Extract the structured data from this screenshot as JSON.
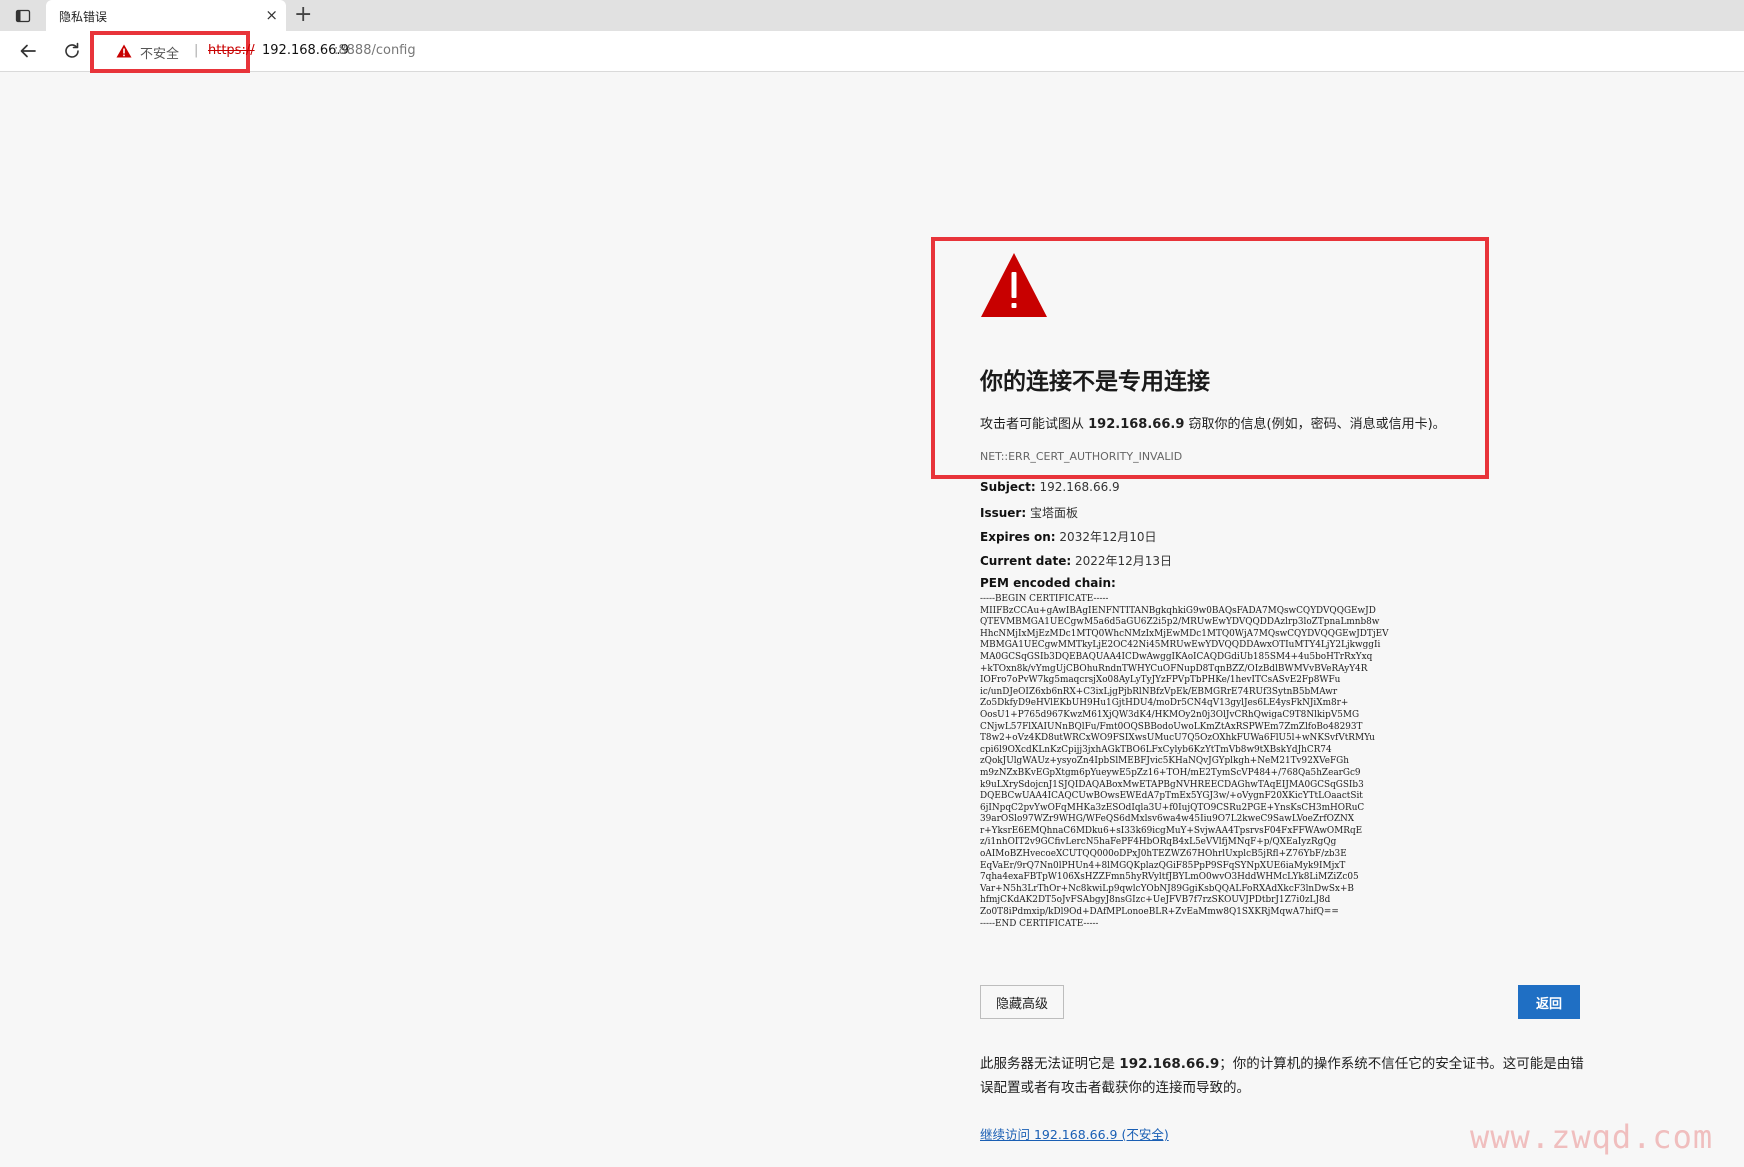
{
  "tab": {
    "title": "隐私错误",
    "close": "×",
    "new": "+"
  },
  "address": {
    "security_label": "不安全",
    "separator": "|",
    "scheme": "https://",
    "host": "192.168.66.9",
    "path": ":8888/config"
  },
  "error": {
    "heading": "你的连接不是专用连接",
    "desc_prefix": "攻击者可能试图从 ",
    "desc_host": "192.168.66.9",
    "desc_suffix": " 窃取你的信息(例如，密码、消息或信用卡)。",
    "code": "NET::ERR_CERT_AUTHORITY_INVALID"
  },
  "details": {
    "subject_label": "Subject:",
    "subject_value": " 192.168.66.9",
    "issuer_label": "Issuer:",
    "issuer_value": " 宝塔面板",
    "expires_label": "Expires on:",
    "expires_value": " 2032年12月10日",
    "current_label": "Current date:",
    "current_value": " 2022年12月13日",
    "pem_label": "PEM encoded chain:"
  },
  "pem": "-----BEGIN CERTIFICATE-----\nMIIFBzCCAu+gAwIBAgIENFNTITANBgkqhkiG9w0BAQsFADA7MQswCQYDVQQGEwJD\nQTEVMBMGA1UECgwM5a6d5aGU6Z2i5p2/MRUwEwYDVQQDDAzlrp3loZTpnaLmnb8w\nHhcNMjIxMjEzMDc1MTQ0WhcNMzIxMjEwMDc1MTQ0WjA7MQswCQYDVQQGEwJDTjEV\nMBMGA1UECgwMMTkyLjE2OC42Ni45MRUwEwYDVQQDDAwxOTIuMTY4LjY2LjkwggIi\nMA0GCSqGSIb3DQEBAQUAA4ICDwAwggIKAoICAQDGdiUb185SM4+4u5boHTrRxYxq\n+kTOxn8k/vYmgUjCBOhuRndnTWHYCuOFNupD8TqnBZZ/OIzBdlBWMVvBVeRAyY4R\nIOFro7oPvW7kg5maqcrsjXo08AyLyTyJYzFPVpTbPHKe/1hevITCsASvE2Fp8WFu\nic/unDJeOIZ6xb6nRX+C3ixLjgPjbRlNBfzVpEk/EBMGRrE74RUf3SytnB5bMAwr\nZo5DkfyD9eHVlEKbUH9Hu1GjtHDU4/moDr5CN4qV13gylJes6LE4ysFkNJiXm8r+\nOosU1+P765d967KwzM61XjQW3dK4/HKMOy2n0j3OlJvCRhQwigaC9T8NlkipV5MG\nCNjwL57FlXAIUNnBQlFu/Fmt0OQSBBodoUwoLKmZtAxRSPWEm7ZmZlfoBo48293T\nT8w2+oVz4KD8utWRCxWO9FSIXwsUMucU7Q5OzOXhkFUWa6FlU5l+wNKSvfVtRMYu\ncpi6l9OXcdKLnKzCpijj3jxhAGkTBO6LFxCylyb6KzYtTmVb8w9tXBskYdJhCR74\nzQokJUlgWAUz+ysyoZn4IpbSlMEBFJvic5KHaNQvJGYplkgh+NeM21Tv92XVeFGh\nm9zNZxBKvEGpXtgm6pYueywE5pZz16+TOH/mE2TymScVP484+/768Qa5hZearGc9\nk9uLXrySdojcnJ1SJQIDAQABoxMwETAPBgNVHREECDAGhwTAqEIJMA0GCSqGSIb3\nDQEBCwUAA4ICAQCUwBOwsEWEdA7pTmEx5YGJ3w/+oVygnF20XKicYTtLOaactSit\n6jINpqC2pvYwOFqMHKa3zESOdIqla3U+f0IujQTO9CSRu2PGE+YnsKsCH3mHORuC\n39arOSlo97WZr9WHG/WFeQS6dMxlsv6wa4w45Iiu9O7L2kweC9SawLVoeZrfOZNX\nr+YksrE6EMQhnaC6MDku6+sI33k69icgMuY+SvjwAA4TpsrvsF04FxFFWAwOMRqE\nz/i1nhOIT2v9GCfivLercN5haFePF4HbORqB4xL5eVVlfjMNqF+p/QXEaIyzRgQg\noAIMoBZHvecoeXCUTQQ000oDPxJ0hTEZWZ67HOhrlUxplcB5jRfl+Z76YbF/zb3E\nEqVaEr/9rQ7Nn0lPHUn4+8lMGQKplazQGiF85PpP9SFqSYNpXUE6iaMyk9IMjxT\n7qha4exaFBTpW106XsHZZFmn5hyRVyltfJBYLmO0wvO3HddWHMcLYk8LiMZiZc05\nVar+N5h3LrThOr+Nc8kwiLp9qwlcYObNJ89GgiKsbQQALFoRXAdXkcF3lnDwSx+B\nhfmjCKdAK2DT5oJvFSAbgyJ8nsGIzc+UeJFVB7f7rzSKOUVJPDtbrJ1Z7i0zLJ8d\nZo0T8iPdmxip/kDl9Od+DAfMPLonoeBLR+ZvEaMmw8Q1SXKRjMqwA7hifQ==\n-----END CERTIFICATE-----",
  "buttons": {
    "hide_advanced": "隐藏高级",
    "back": "返回"
  },
  "explanation": {
    "prefix": "此服务器无法证明它是 ",
    "host": "192.168.66.9",
    "suffix": "；你的计算机的操作系统不信任它的安全证书。这可能是由错误配置或者有攻击者截获你的连接而导致的。"
  },
  "proceed_link": "继续访问 192.168.66.9 (不安全)",
  "watermark": "www.zwqd.com",
  "colors": {
    "alert_red": "#c80000",
    "highlight_red": "#e8343a",
    "primary_blue": "#1f6fc4",
    "link_blue": "#1a5fb4"
  },
  "icons": {
    "tab_actions": "tab-actions-icon",
    "back": "back-arrow-icon",
    "reload": "reload-icon",
    "warning": "warning-triangle-icon"
  }
}
